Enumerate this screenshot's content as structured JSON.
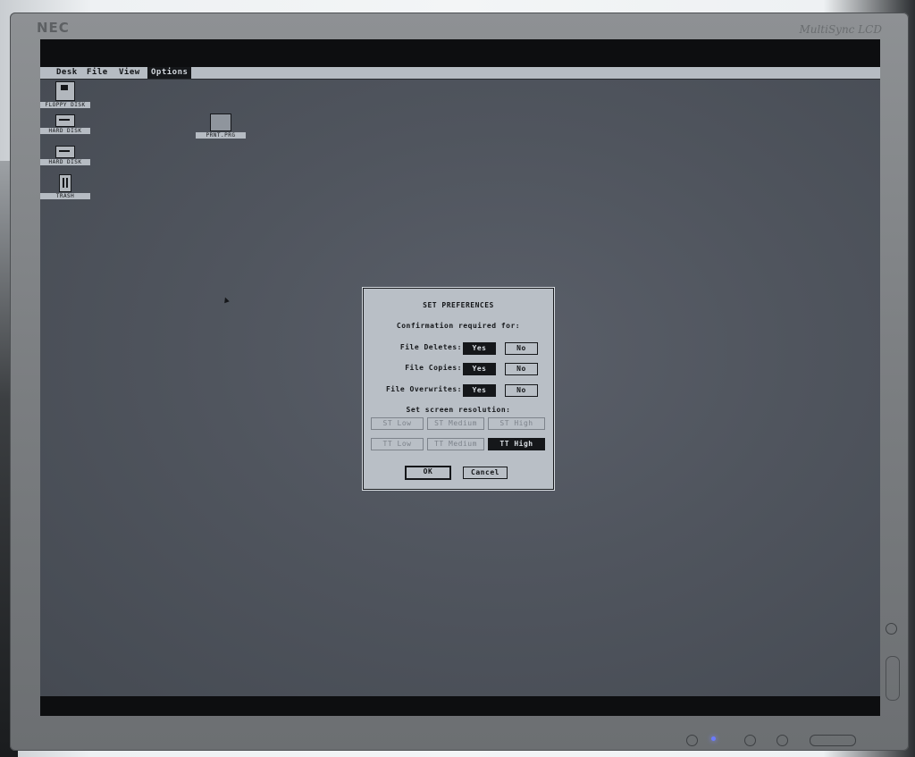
{
  "monitor": {
    "brand": "NEC",
    "model": "MultiSync LCD"
  },
  "menubar": {
    "items": [
      "Desk",
      "File",
      "View",
      "Options"
    ],
    "active": "Options"
  },
  "desktop_icons": [
    {
      "label": "FLOPPY DISK",
      "icon": "floppy-disk-icon"
    },
    {
      "label": "HARD DISK",
      "icon": "hard-disk-icon"
    },
    {
      "label": "HARD DISK",
      "icon": "hard-disk-icon"
    },
    {
      "label": "TRASH",
      "icon": "trash-icon"
    },
    {
      "label": "PRNT.PRG",
      "icon": "program-icon"
    }
  ],
  "dialog": {
    "title": "SET PREFERENCES",
    "subtitle": "Confirmation required for:",
    "rows": [
      {
        "label": "File Deletes:",
        "yes": "Yes",
        "no": "No",
        "selected": "yes"
      },
      {
        "label": "File Copies:",
        "yes": "Yes",
        "no": "No",
        "selected": "yes"
      },
      {
        "label": "File Overwrites:",
        "yes": "Yes",
        "no": "No",
        "selected": "yes"
      }
    ],
    "resolution_label": "Set screen resolution:",
    "resolutions": [
      {
        "label": "ST Low",
        "state": "disabled"
      },
      {
        "label": "ST Medium",
        "state": "disabled"
      },
      {
        "label": "ST High",
        "state": "disabled"
      },
      {
        "label": "TT Low",
        "state": "disabled"
      },
      {
        "label": "TT Medium",
        "state": "disabled"
      },
      {
        "label": "TT High",
        "state": "selected"
      }
    ],
    "ok": "OK",
    "cancel": "Cancel"
  },
  "colors": {
    "desktop": "#50555e",
    "dialog": "#b9bfc6",
    "selected": "#15171a",
    "power_led": "#6b7bff"
  }
}
